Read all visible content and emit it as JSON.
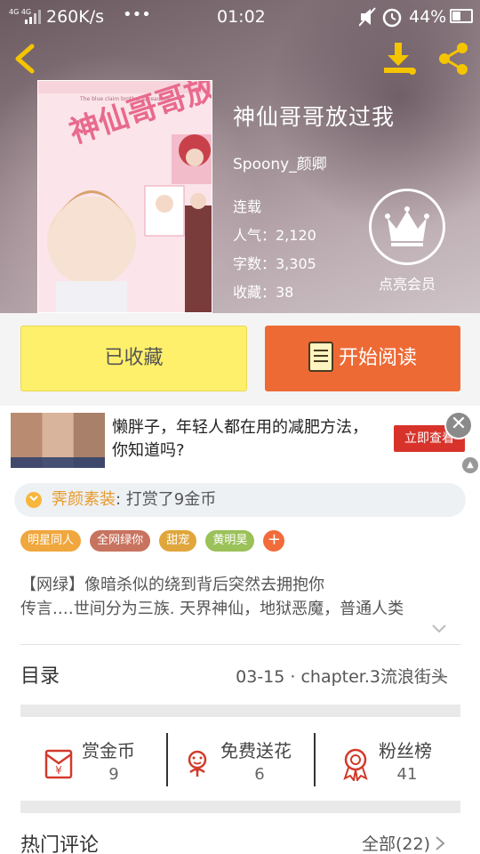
{
  "status_bar": {
    "signal": "4G 4G",
    "speed": "260K/s",
    "more": "•••",
    "time": "01:02",
    "battery": "44%"
  },
  "book": {
    "title": "神仙哥哥放过我",
    "author": "Spoony_颜卿",
    "status": "连载",
    "popularity": "人气：2,120",
    "word_count": "字数：3,305",
    "favorites": "收藏：38",
    "cover_title_art": "神仙哥哥放过我",
    "cover_tagline": "The blue claim brother spread me"
  },
  "vip": {
    "label": "点亮会员"
  },
  "actions": {
    "collected_label": "已收藏",
    "read_label": "开始阅读"
  },
  "ad": {
    "text": "懒胖子，年轻人都在用的减肥方法，你知道吗?",
    "cta": "立即查看",
    "close": "✕"
  },
  "reward": {
    "name": "霁颜素装",
    "action": ": 打赏了9金币"
  },
  "tags": [
    {
      "label": "明星同人",
      "color": "#f0a73d"
    },
    {
      "label": "全网绿你",
      "color": "#c8735f"
    },
    {
      "label": "甜宠",
      "color": "#e0a63b"
    },
    {
      "label": "黄明昊",
      "color": "#9bc159"
    }
  ],
  "tag_add": "+",
  "description": {
    "line1": "【网绿】像暗杀似的绕到背后突然去拥抱你",
    "line2": "传言.…世间分为三族. 天界神仙，地狱恶魔，普通人类"
  },
  "toc": {
    "label": "目录",
    "latest": "03-15 · chapter.3流浪街头"
  },
  "stats": [
    {
      "name": "赏金币",
      "value": "9"
    },
    {
      "name": "免费送花",
      "value": "6"
    },
    {
      "name": "粉丝榜",
      "value": "41"
    }
  ],
  "comments": {
    "label": "热门评论",
    "all": "全部(22)"
  },
  "colors": {
    "accent_orange": "#ee6a35",
    "collected_yellow": "#fff06b",
    "icon_yellow": "#f5c400",
    "icon_red": "#d23a2a"
  }
}
